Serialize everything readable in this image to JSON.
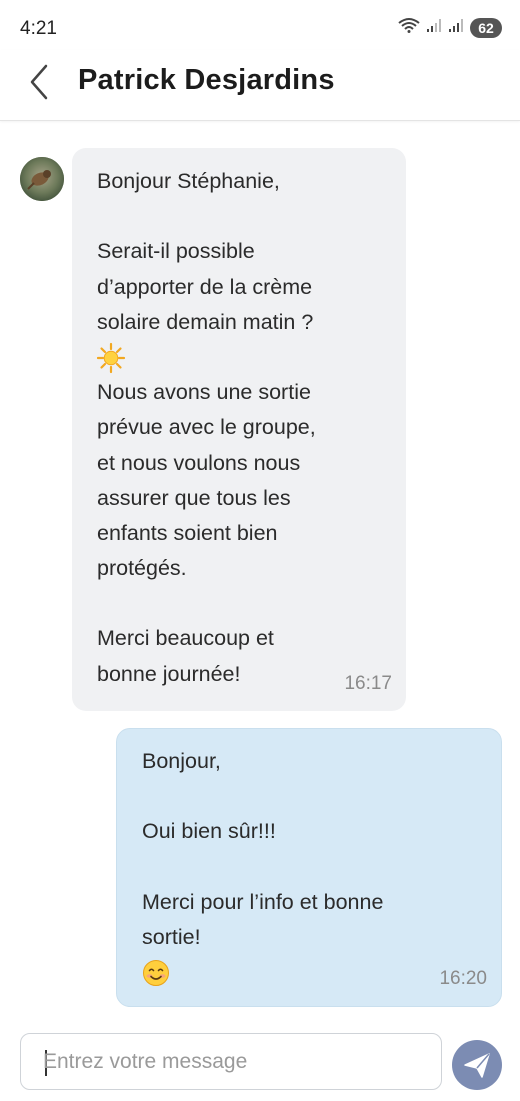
{
  "status_bar": {
    "time": "4:21",
    "battery": "62",
    "icons": [
      "wifi-icon",
      "signal-icon",
      "signal-icon",
      "battery-icon"
    ]
  },
  "header": {
    "back_icon": "chevron-left-icon",
    "title": "Patrick Desjardins"
  },
  "messages": [
    {
      "direction": "incoming",
      "lines": [
        "Bonjour Stéphanie,",
        "",
        "Serait-il possible",
        "d’apporter de la crème",
        "solaire demain matin ?",
        "☀️",
        "Nous avons une sortie",
        "prévue avec le groupe,",
        "et nous voulons nous",
        "assurer que tous les",
        "enfants soient bien",
        "protégés.",
        "",
        "Merci beaucoup et",
        "bonne journée!"
      ],
      "time": "16:17"
    },
    {
      "direction": "outgoing",
      "lines": [
        "Bonjour,",
        "",
        "Oui bien sûr!!!",
        "",
        "Merci pour l’info et bonne",
        "sortie!",
        "😊"
      ],
      "time": "16:20"
    }
  ],
  "composer": {
    "placeholder": "Entrez votre message",
    "value": "",
    "send_icon": "send-icon"
  },
  "colors": {
    "incoming_bubble": "#f0f1f3",
    "outgoing_bubble": "#d6e9f6",
    "send_button": "#7c8cb3",
    "timestamp": "#8a8a8a"
  }
}
